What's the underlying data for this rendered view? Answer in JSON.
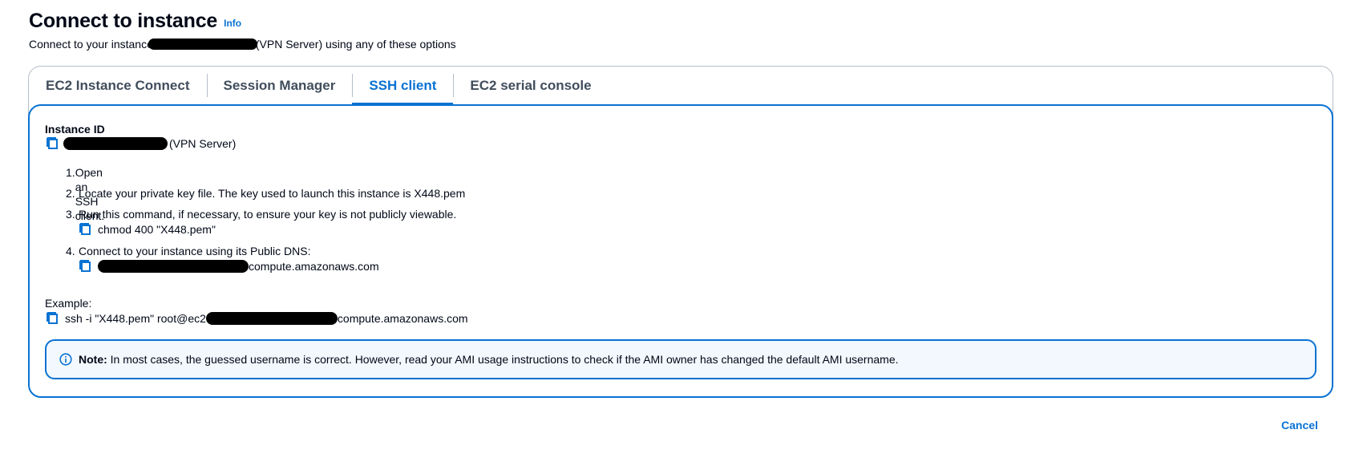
{
  "header": {
    "title": "Connect to instance",
    "info_link": "Info",
    "subtitle_prefix": "Connect to your instance",
    "subtitle_suffix": "(VPN Server) using any of these options"
  },
  "tabs": [
    {
      "label": "EC2 Instance Connect",
      "active": false
    },
    {
      "label": "Session Manager",
      "active": false
    },
    {
      "label": "SSH client",
      "active": true
    },
    {
      "label": "EC2 serial console",
      "active": false
    }
  ],
  "panel": {
    "instance_id_label": "Instance ID",
    "instance_id_suffix": "(VPN Server)",
    "steps": [
      {
        "num": "1.",
        "text": "Open an SSH client."
      },
      {
        "num": "2.",
        "text": "Locate your private key file. The key used to launch this instance is X448.pem"
      },
      {
        "num": "3.",
        "text": "Run this command, if necessary, to ensure your key is not publicly viewable.",
        "command": "chmod 400 \"X448.pem\""
      },
      {
        "num": "4.",
        "text": "Connect to your instance using its Public DNS:",
        "command_suffix": "compute.amazonaws.com"
      }
    ],
    "example_label": "Example:",
    "example_prefix": "ssh -i \"X448.pem\" root@ec2",
    "example_suffix": "compute.amazonaws.com",
    "note_bold": "Note:",
    "note_text": "In most cases, the guessed username is correct. However, read your AMI usage instructions to check if the AMI owner has changed the default AMI username."
  },
  "footer": {
    "cancel_label": "Cancel"
  },
  "colors": {
    "accent": "#0972d3",
    "text": "#000716",
    "tab_inactive": "#414d5c",
    "border": "#b6bec9",
    "note_bg": "#f2f8fd",
    "redaction": "#000000"
  },
  "icons": {
    "copy": "copy-icon",
    "info": "info-circle-icon"
  }
}
